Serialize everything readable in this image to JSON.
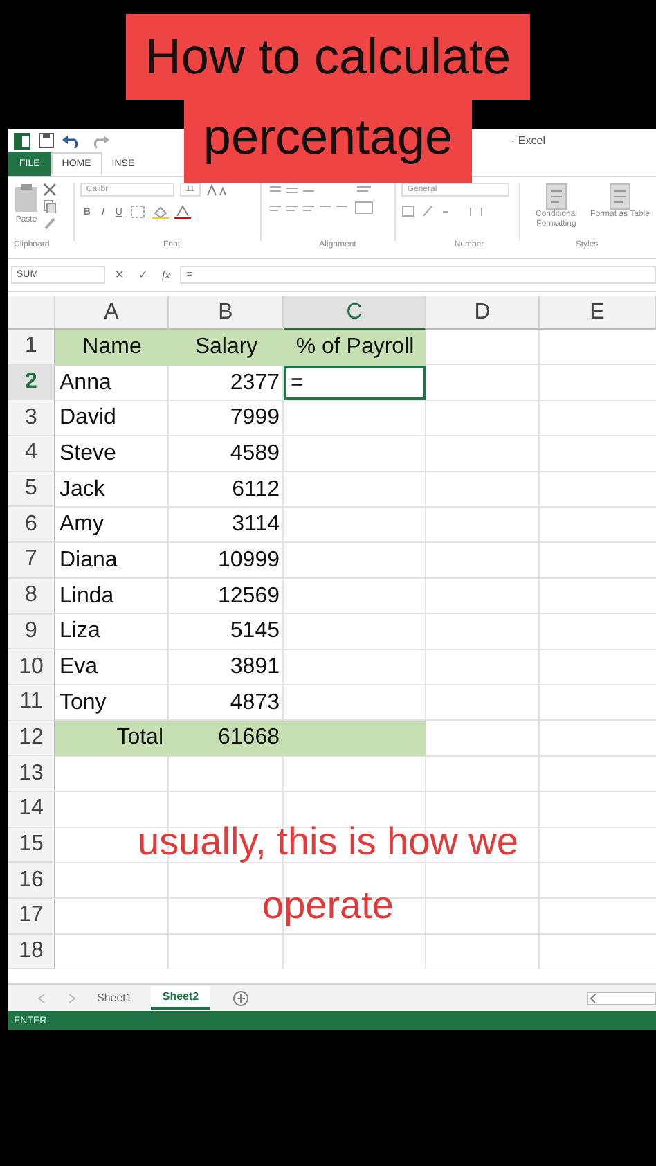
{
  "caption_top": {
    "lines": [
      "How to calculate",
      "percentage"
    ]
  },
  "window": {
    "title": "- Excel"
  },
  "ribbon_tabs": [
    {
      "label": "FILE",
      "kind": "file",
      "selected": false
    },
    {
      "label": "HOME",
      "kind": "tab",
      "selected": true
    },
    {
      "label": "INSE",
      "kind": "tab",
      "selected": false
    }
  ],
  "ribbon": {
    "paste": "Paste",
    "font_name": "Calibri",
    "font_size": "11",
    "font_buttons": [
      "B",
      "I",
      "U"
    ],
    "number_format": "General",
    "styles": [
      "Conditional Formatting",
      "Format as Table"
    ],
    "groups": [
      "Clipboard",
      "Font",
      "Alignment",
      "Number",
      "Styles"
    ]
  },
  "formula_bar": {
    "name_box": "SUM",
    "buttons": [
      "✕",
      "✓",
      "fx"
    ],
    "formula": "="
  },
  "sheet": {
    "columns": [
      {
        "label": "A",
        "selected": false
      },
      {
        "label": "B",
        "selected": false
      },
      {
        "label": "C",
        "selected": true
      },
      {
        "label": "D",
        "selected": false
      },
      {
        "label": "E",
        "selected": false
      }
    ],
    "rows": [
      {
        "number": "1",
        "selected": false,
        "kind": "header",
        "cells": [
          "Name",
          "Salary",
          "% of Payroll"
        ]
      },
      {
        "number": "2",
        "selected": true,
        "kind": "data",
        "cells": [
          "Anna",
          "2377",
          {
            "text": "=",
            "active": true
          }
        ]
      },
      {
        "number": "3",
        "selected": false,
        "kind": "data",
        "cells": [
          "David",
          "7999"
        ]
      },
      {
        "number": "4",
        "selected": false,
        "kind": "data",
        "cells": [
          "Steve",
          "4589"
        ]
      },
      {
        "number": "5",
        "selected": false,
        "kind": "data",
        "cells": [
          "Jack",
          "6112"
        ]
      },
      {
        "number": "6",
        "selected": false,
        "kind": "data",
        "cells": [
          "Amy",
          "3114"
        ]
      },
      {
        "number": "7",
        "selected": false,
        "kind": "data",
        "cells": [
          "Diana",
          "10999"
        ]
      },
      {
        "number": "8",
        "selected": false,
        "kind": "data",
        "cells": [
          "Linda",
          "12569"
        ]
      },
      {
        "number": "9",
        "selected": false,
        "kind": "data",
        "cells": [
          "Liza",
          "5145"
        ]
      },
      {
        "number": "10",
        "selected": false,
        "kind": "data",
        "cells": [
          "Eva",
          "3891"
        ]
      },
      {
        "number": "11",
        "selected": false,
        "kind": "data",
        "cells": [
          "Tony",
          "4873"
        ]
      },
      {
        "number": "12",
        "selected": false,
        "kind": "total",
        "cells": [
          "Total",
          "61668"
        ]
      },
      {
        "number": "13",
        "selected": false,
        "kind": "data",
        "cells": []
      },
      {
        "number": "14",
        "selected": false,
        "kind": "data",
        "cells": []
      },
      {
        "number": "15",
        "selected": false,
        "kind": "data",
        "cells": []
      },
      {
        "number": "16",
        "selected": false,
        "kind": "data",
        "cells": []
      },
      {
        "number": "17",
        "selected": false,
        "kind": "data",
        "cells": []
      },
      {
        "number": "18",
        "selected": false,
        "kind": "data",
        "cells": []
      }
    ]
  },
  "sheet_tabs": [
    {
      "label": "Sheet1",
      "selected": false
    },
    {
      "label": "Sheet2",
      "selected": true
    }
  ],
  "status_bar": {
    "mode": "ENTER"
  },
  "caption_bottom": {
    "lines": [
      "usually, this is how we",
      "operate"
    ]
  }
}
